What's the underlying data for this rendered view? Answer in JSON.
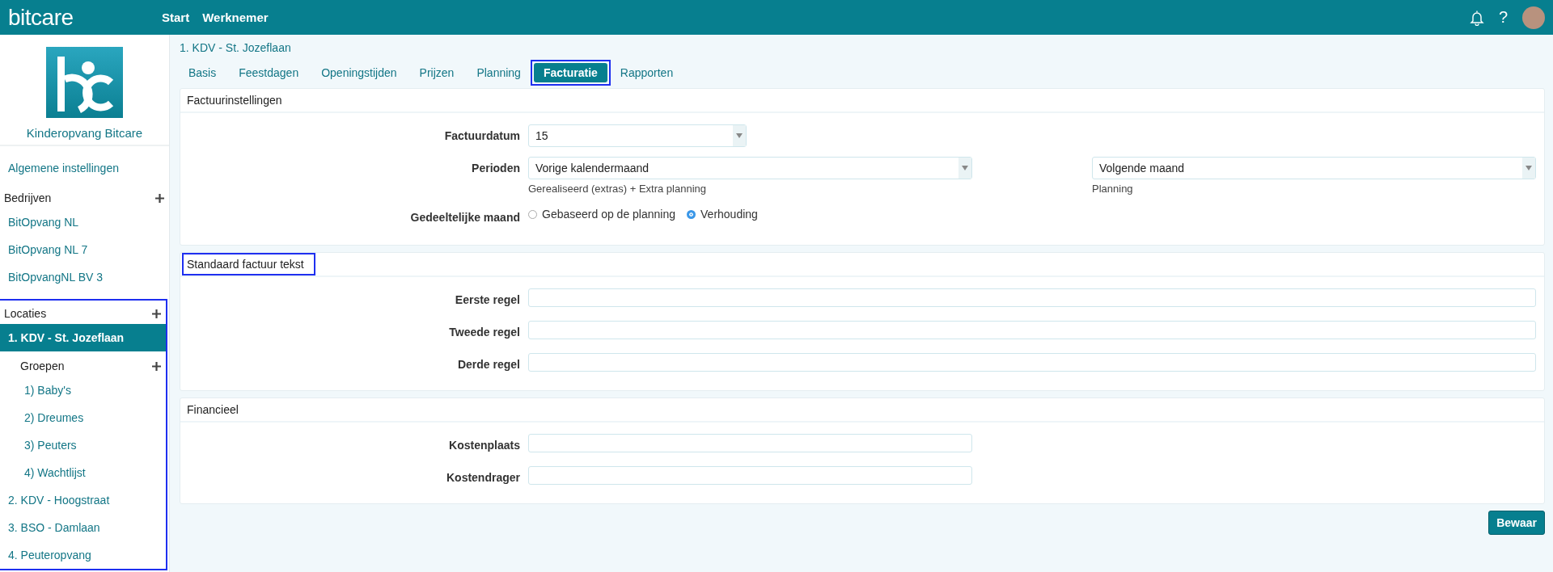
{
  "header": {
    "logo": "bitcare",
    "nav": [
      {
        "label": "Start"
      },
      {
        "label": "Werknemer"
      }
    ],
    "help": "?"
  },
  "sidebar": {
    "org_name": "Kinderopvang Bitcare",
    "general_link": "Algemene instellingen",
    "sections": [
      {
        "title": "Bedrijven",
        "highlighted": false,
        "items": [
          {
            "label": "BitOpvang NL",
            "selected": false
          },
          {
            "label": "BitOpvang NL 7",
            "selected": false
          },
          {
            "label": "BitOpvangNL BV 3",
            "selected": false
          }
        ]
      },
      {
        "title": "Locaties",
        "highlighted": true,
        "items": [
          {
            "label": "1. KDV - St. Jozeflaan",
            "selected": true,
            "subsection": {
              "title": "Groepen",
              "items": [
                {
                  "label": "1) Baby's",
                  "selected": false
                },
                {
                  "label": "2) Dreumes",
                  "selected": false
                },
                {
                  "label": "3) Peuters",
                  "selected": false
                },
                {
                  "label": "4) Wachtlijst",
                  "selected": false
                }
              ]
            }
          },
          {
            "label": "2. KDV - Hoogstraat",
            "selected": false
          },
          {
            "label": "3. BSO - Damlaan",
            "selected": false
          },
          {
            "label": "4. Peuteropvang",
            "selected": false
          }
        ]
      }
    ]
  },
  "main": {
    "breadcrumb": "1. KDV - St. Jozeflaan",
    "tabs": [
      {
        "label": "Basis",
        "selected": false,
        "highlighted": false
      },
      {
        "label": "Feestdagen",
        "selected": false,
        "highlighted": false
      },
      {
        "label": "Openingstijden",
        "selected": false,
        "highlighted": false
      },
      {
        "label": "Prijzen",
        "selected": false,
        "highlighted": false
      },
      {
        "label": "Planning",
        "selected": false,
        "highlighted": false
      },
      {
        "label": "Facturatie",
        "selected": true,
        "highlighted": true
      },
      {
        "label": "Rapporten",
        "selected": false,
        "highlighted": false
      }
    ],
    "sections": [
      {
        "title": "Factuurinstellingen",
        "highlighted": false,
        "fields": [
          {
            "kind": "select",
            "label": "Factuurdatum",
            "selects": [
              {
                "value": "15"
              }
            ]
          },
          {
            "kind": "double-select",
            "label": "Perioden",
            "selects": [
              {
                "value": "Vorige kalendermaand",
                "hint": "Gerealiseerd (extras) + Extra planning"
              },
              {
                "value": "Volgende maand",
                "hint": "Planning"
              }
            ]
          },
          {
            "kind": "radio",
            "label": "Gedeeltelijke maand",
            "options": [
              {
                "label": "Gebaseerd op de planning",
                "selected": false
              },
              {
                "label": "Verhouding",
                "selected": true
              }
            ]
          }
        ]
      },
      {
        "title": "Standaard factuur tekst",
        "highlighted": true,
        "fields": [
          {
            "kind": "text",
            "label": "Eerste regel"
          },
          {
            "kind": "text",
            "label": "Tweede regel"
          },
          {
            "kind": "text",
            "label": "Derde regel"
          }
        ]
      },
      {
        "title": "Financieel",
        "highlighted": false,
        "fields": [
          {
            "kind": "short-text",
            "label": "Kostenplaats"
          },
          {
            "kind": "short-text",
            "label": "Kostendrager"
          }
        ]
      }
    ],
    "save_button": "Bewaar"
  }
}
